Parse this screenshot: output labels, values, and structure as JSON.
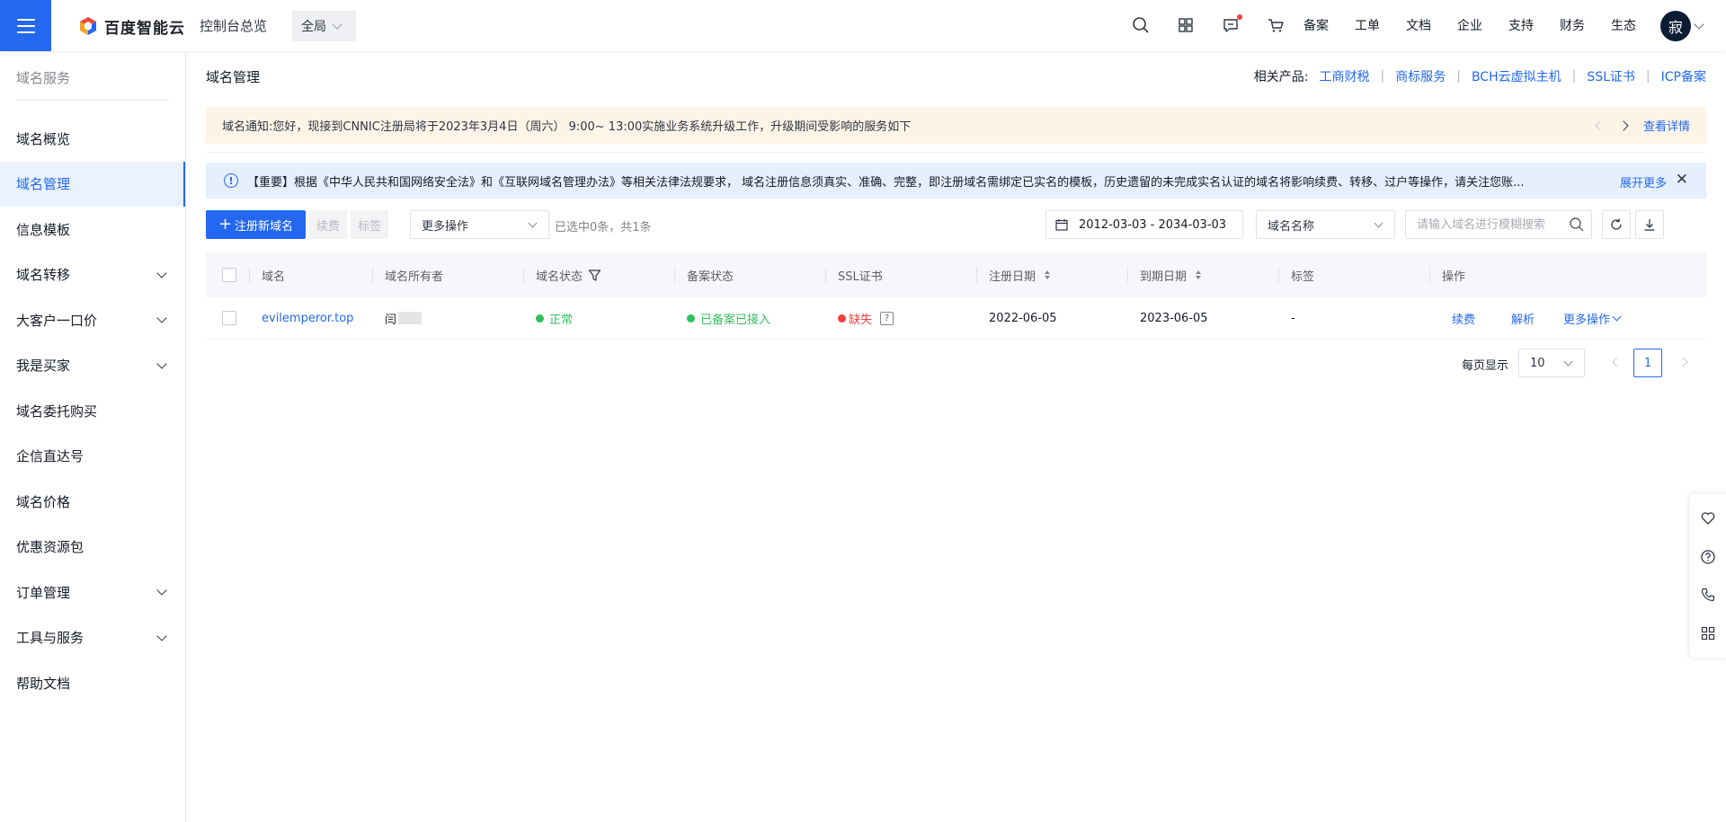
{
  "header": {
    "brand": "百度智能云",
    "console_overview": "控制台总览",
    "region": "全局",
    "nav": [
      "备案",
      "工单",
      "文档",
      "企业",
      "支持",
      "财务",
      "生态"
    ],
    "avatar_text": "寂"
  },
  "sidebar": {
    "title": "域名服务",
    "items": [
      {
        "label": "域名概览",
        "expandable": false
      },
      {
        "label": "域名管理",
        "expandable": false,
        "active": true
      },
      {
        "label": "信息模板",
        "expandable": false
      },
      {
        "label": "域名转移",
        "expandable": true
      },
      {
        "label": "大客户一口价",
        "expandable": true
      },
      {
        "label": "我是买家",
        "expandable": true
      },
      {
        "label": "域名委托购买",
        "expandable": false
      },
      {
        "label": "企信直达号",
        "expandable": false
      },
      {
        "label": "域名价格",
        "expandable": false
      },
      {
        "label": "优惠资源包",
        "expandable": false
      },
      {
        "label": "订单管理",
        "expandable": true
      },
      {
        "label": "工具与服务",
        "expandable": true
      },
      {
        "label": "帮助文档",
        "expandable": false
      }
    ]
  },
  "main": {
    "title": "域名管理",
    "related_label": "相关产品:",
    "related_links": [
      "工商财税",
      "商标服务",
      "BCH云虚拟主机",
      "SSL证书",
      "ICP备案"
    ],
    "notice": {
      "text": "域名通知:您好，现接到CNNIC注册局将于2023年3月4日（周六） 9:00~ 13:00实施业务系统升级工作，升级期间受影响的服务如下",
      "detail_link": "查看详情"
    },
    "alert": {
      "text": "【重要】根据《中华人民共和国网络安全法》和《互联网域名管理办法》等相关法律法规要求， 域名注册信息须真实、准确、完整，即注册域名需绑定已实名的模板，历史遗留的未完成实名认证的域名将影响续费、转移、过户等操作，请关注您账...",
      "more": "展开更多"
    },
    "toolbar": {
      "register_button": "注册新域名",
      "renew_button": "续费",
      "tag_button": "标签",
      "more_actions": "更多操作",
      "selected_info": "已选中0条，共1条",
      "date_range": "2012-03-03 - 2034-03-03",
      "search_field": "域名名称",
      "search_placeholder": "请输入域名进行模糊搜索"
    },
    "table": {
      "columns": [
        "域名",
        "域名所有者",
        "域名状态",
        "备案状态",
        "SSL证书",
        "注册日期",
        "到期日期",
        "标签",
        "操作"
      ],
      "rows": [
        {
          "domain": "evilemperor.top",
          "owner": "闫",
          "status": "正常",
          "icp_status": "已备案已接入",
          "ssl": "缺失",
          "ssl_help": "?",
          "reg_date": "2022-06-05",
          "exp_date": "2023-06-05",
          "tag": "-",
          "ops": [
            "续费",
            "解析",
            "更多操作"
          ]
        }
      ]
    },
    "pagination": {
      "page_size_label": "每页显示",
      "page_size": "10",
      "current_page": "1"
    }
  },
  "colors": {
    "primary": "#2468f2",
    "success": "#30bf5c",
    "danger": "#f33e3e",
    "notice_bg": "#fdf4e8",
    "alert_bg": "#e6effe"
  }
}
